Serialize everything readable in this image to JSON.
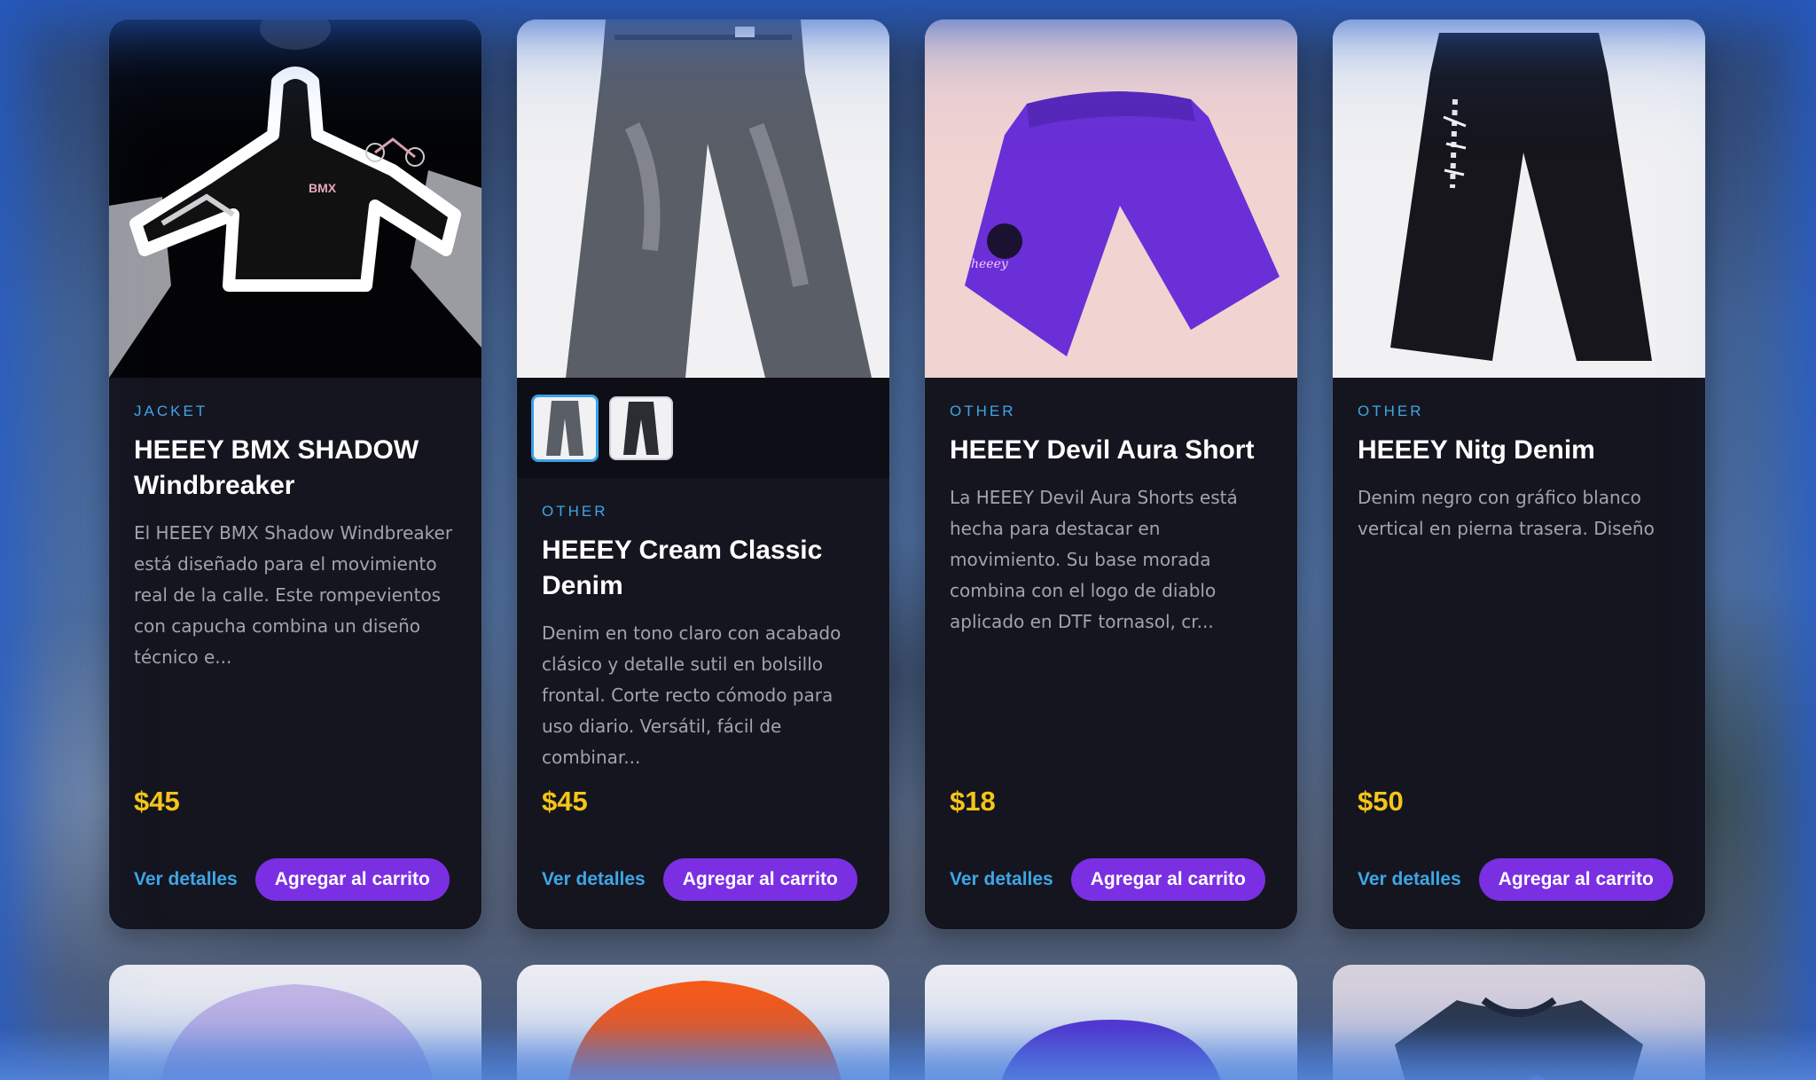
{
  "products": [
    {
      "category": "JACKET",
      "title": "HEEEY BMX SHADOW Windbreaker",
      "description": "El HEEEY BMX Shadow Windbreaker está diseñado para el movimiento real de la calle. Este rompevientos con capucha combina un diseño técnico e...",
      "price": "$45",
      "details_label": "Ver detalles",
      "cart_label": "Agregar al carrito",
      "image_bg": "#000000",
      "image_icon": "windbreaker-jacket-image"
    },
    {
      "category": "OTHER",
      "title": "HEEEY Cream Classic Denim",
      "description": "Denim en tono claro con acabado clásico y detalle sutil en bolsillo frontal. Corte recto cómodo para uso diario. Versátil, fácil de combinar...",
      "price": "$45",
      "details_label": "Ver detalles",
      "cart_label": "Agregar al carrito",
      "image_bg": "#f1f1f3",
      "image_icon": "grey-denim-jeans-image"
    },
    {
      "category": "OTHER",
      "title": "HEEEY Devil Aura Short",
      "description": "La HEEEY Devil Aura Shorts está hecha para destacar en movimiento. Su base morada combina con el logo de diablo aplicado en DTF tornasol, cr...",
      "price": "$18",
      "details_label": "Ver detalles",
      "cart_label": "Agregar al carrito",
      "image_bg": "#f1d3d2",
      "image_icon": "purple-shorts-image"
    },
    {
      "category": "OTHER",
      "title": "HEEEY Nitg Denim",
      "description": "Denim negro con gráfico blanco vertical en pierna trasera. Diseño",
      "price": "$50",
      "details_label": "Ver detalles",
      "cart_label": "Agregar al carrito",
      "image_bg": "#f1f1f3",
      "image_icon": "black-denim-jeans-image"
    }
  ],
  "second_row": [
    {
      "image_icon": "lavender-beanie-image",
      "image_bg": "#efeff1"
    },
    {
      "image_icon": "orange-beanie-image",
      "image_bg": "#f1f1f3"
    },
    {
      "image_icon": "purple-beanie-image",
      "image_bg": "#f1f1f3"
    },
    {
      "image_icon": "black-tshirt-image",
      "image_bg": "#dcd4dc"
    }
  ],
  "colors": {
    "card_bg": "#15151f",
    "accent_blue": "#3ea6e6",
    "button_purple": "#7b2fe3",
    "price_yellow": "#f5c518"
  }
}
